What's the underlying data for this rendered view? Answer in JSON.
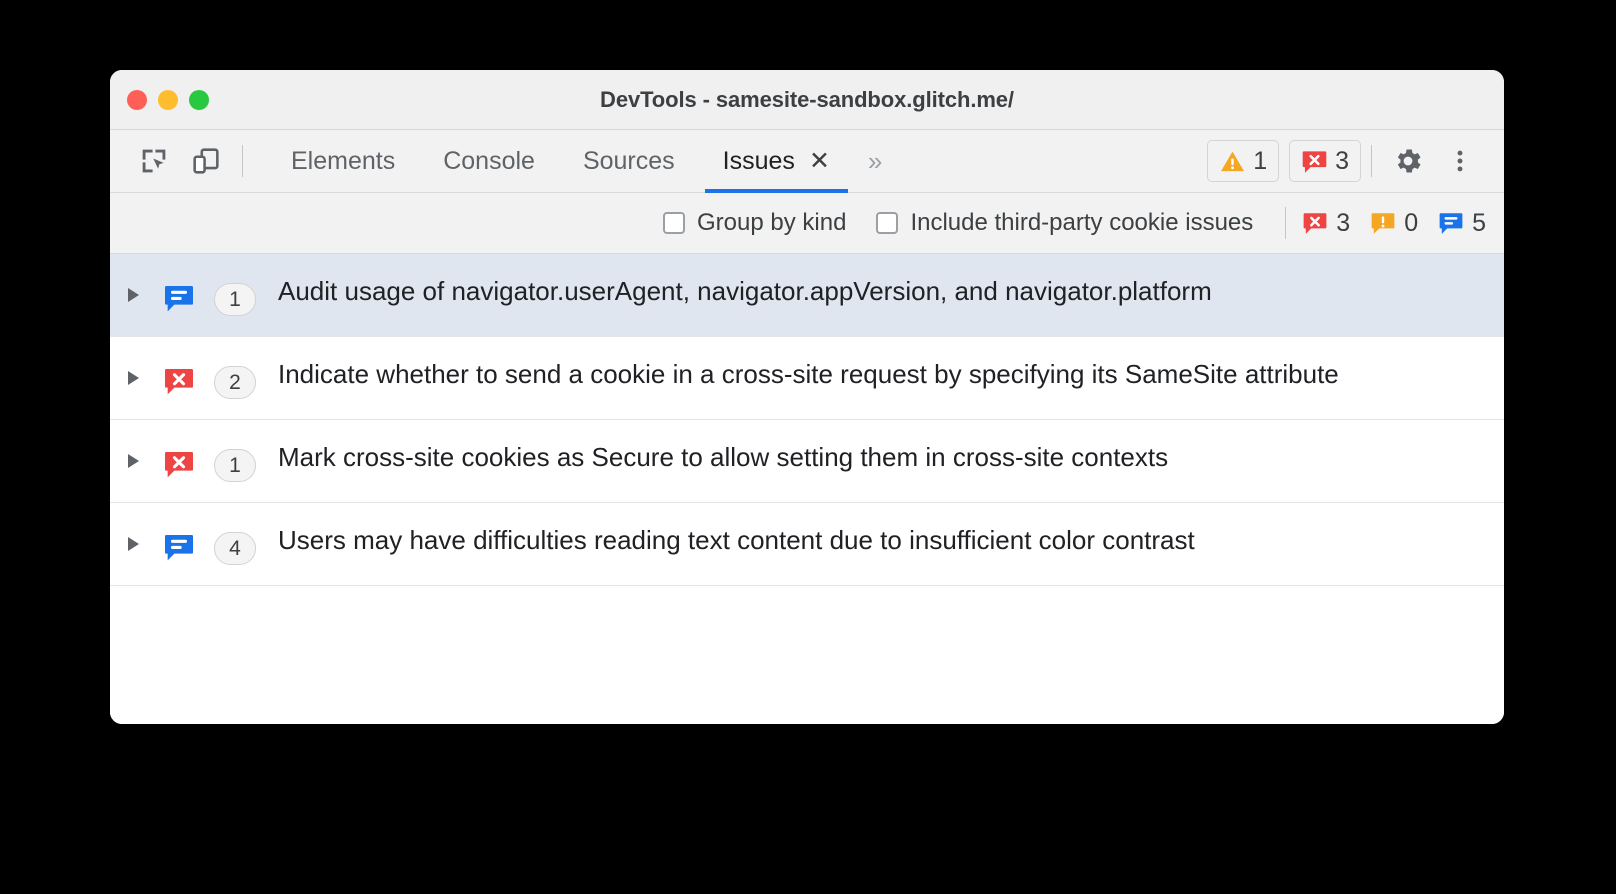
{
  "window": {
    "title": "DevTools - samesite-sandbox.glitch.me/",
    "traffic_lights": [
      "close",
      "minimize",
      "maximize"
    ]
  },
  "toolbar": {
    "inspect_icon": "inspect-element-icon",
    "device_icon": "device-toolbar-icon",
    "tabs": [
      {
        "label": "Elements",
        "active": false,
        "closable": false
      },
      {
        "label": "Console",
        "active": false,
        "closable": false
      },
      {
        "label": "Sources",
        "active": false,
        "closable": false
      },
      {
        "label": "Issues",
        "active": true,
        "closable": true,
        "close_glyph": "✕"
      }
    ],
    "more_tabs_glyph": "»",
    "warning_count": "1",
    "error_count": "3",
    "settings_icon": "gear-icon",
    "menu_icon": "kebab-menu-icon"
  },
  "filterbar": {
    "group_by_kind_label": "Group by kind",
    "group_by_kind_checked": false,
    "third_party_label": "Include third-party cookie issues",
    "third_party_checked": false,
    "tallies": [
      {
        "kind": "page-error",
        "count": "3"
      },
      {
        "kind": "breaking-change",
        "count": "0"
      },
      {
        "kind": "improvement",
        "count": "5"
      }
    ]
  },
  "issues": [
    {
      "kind": "improvement",
      "count": "1",
      "title": "Audit usage of navigator.userAgent, navigator.appVersion, and navigator.platform",
      "selected": true,
      "expanded": false
    },
    {
      "kind": "page-error",
      "count": "2",
      "title": "Indicate whether to send a cookie in a cross-site request by specifying its SameSite attribute",
      "selected": false,
      "expanded": false
    },
    {
      "kind": "page-error",
      "count": "1",
      "title": "Mark cross-site cookies as Secure to allow setting them in cross-site contexts",
      "selected": false,
      "expanded": false
    },
    {
      "kind": "improvement",
      "count": "4",
      "title": "Users may have difficulties reading text content due to insufficient color contrast",
      "selected": false,
      "expanded": false
    }
  ],
  "colors": {
    "accent_blue": "#1a73e8",
    "error_red": "#ee4444",
    "warning_orange": "#f5a623",
    "info_blue": "#1a73e8",
    "selected_row": "#dfe6ef",
    "chrome_gray": "#f2f2f2"
  }
}
